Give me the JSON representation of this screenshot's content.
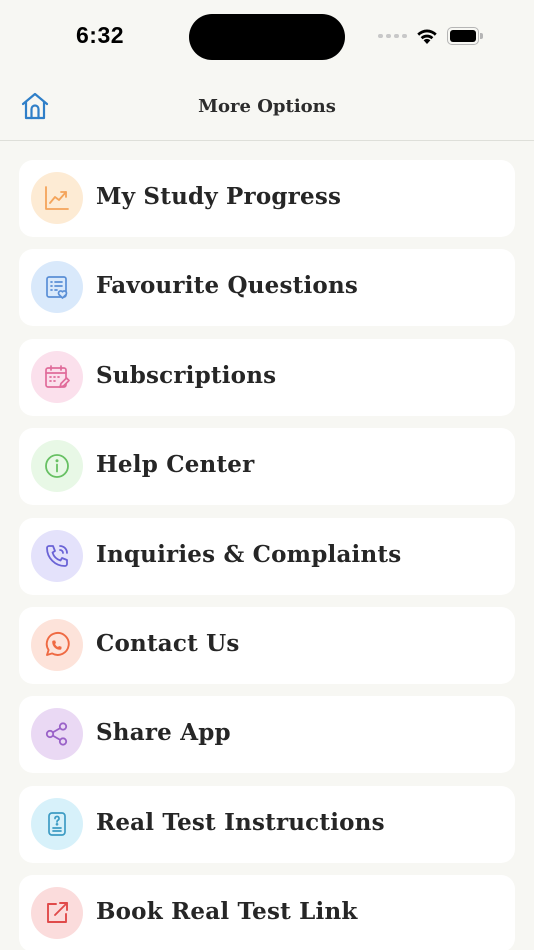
{
  "status": {
    "time": "6:32"
  },
  "nav": {
    "title": "More Options"
  },
  "items": [
    {
      "label": "My Study Progress",
      "icon": "trend-chart-icon",
      "bg": "#fdebd4",
      "color": "#f4a45a"
    },
    {
      "label": "Favourite Questions",
      "icon": "list-heart-icon",
      "bg": "#d9e9fb",
      "color": "#5a8fd6"
    },
    {
      "label": "Subscriptions",
      "icon": "calendar-edit-icon",
      "bg": "#fbe0ec",
      "color": "#e06b9a"
    },
    {
      "label": "Help Center",
      "icon": "info-icon",
      "bg": "#e8f8e6",
      "color": "#67c063"
    },
    {
      "label": "Inquiries & Complaints",
      "icon": "phone-call-icon",
      "bg": "#e4e2fb",
      "color": "#6a63d6"
    },
    {
      "label": "Contact Us",
      "icon": "whatsapp-icon",
      "bg": "#fde3da",
      "color": "#ef6a43"
    },
    {
      "label": "Share App",
      "icon": "share-icon",
      "bg": "#ead9f4",
      "color": "#9a62c8"
    },
    {
      "label": "Real Test Instructions",
      "icon": "document-question-icon",
      "bg": "#d7f1fa",
      "color": "#3d9cc4"
    },
    {
      "label": "Book Real Test Link",
      "icon": "external-link-icon",
      "bg": "#fbdcdc",
      "color": "#e04a4a"
    }
  ]
}
